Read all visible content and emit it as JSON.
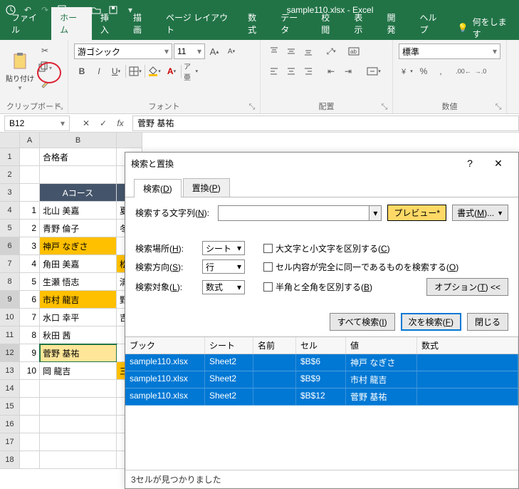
{
  "title": "sample110.xlsx - Excel",
  "qat": {
    "autosave": "autosave-icon",
    "items": [
      "undo-icon",
      "redo-icon",
      "new-icon",
      "open-icon",
      "open2-icon",
      "save-icon"
    ]
  },
  "tabs": {
    "file": "ファイル",
    "home": "ホーム",
    "insert": "挿入",
    "draw": "描画",
    "layout": "ページ レイアウト",
    "formula": "数式",
    "data": "データ",
    "review": "校閲",
    "view": "表示",
    "dev": "開発",
    "help": "ヘルプ",
    "tell": "何をします"
  },
  "ribbon": {
    "clipboard": {
      "paste": "貼り付け",
      "label": "クリップボード"
    },
    "font": {
      "name": "游ゴシック",
      "size": "11",
      "b": "B",
      "i": "I",
      "u": "U",
      "label": "フォント"
    },
    "align": {
      "label": "配置"
    },
    "number": {
      "style": "標準",
      "label": "数値"
    }
  },
  "formulabar": {
    "namebox": "B12",
    "value": "菅野 基祐"
  },
  "sheet": {
    "colheads": [
      "A",
      "B"
    ],
    "a1": "合格者",
    "b_header": "Aコース",
    "rows": [
      {
        "n": "1",
        "name": "北山 美嘉",
        "c": "夏"
      },
      {
        "n": "2",
        "name": "青野 倫子",
        "c": "冬"
      },
      {
        "n": "3",
        "name": "神戸 なぎさ",
        "c": "",
        "hl": true,
        "row_sel": true
      },
      {
        "n": "4",
        "name": "角田 美嘉",
        "c": "松",
        "chl": true
      },
      {
        "n": "5",
        "name": "生瀬 悟志",
        "c": "清"
      },
      {
        "n": "6",
        "name": "市村 龍吉",
        "c": "野",
        "hl": true,
        "row_sel": true
      },
      {
        "n": "7",
        "name": "水口 幸平",
        "c": "吉"
      },
      {
        "n": "8",
        "name": "秋田 茜",
        "c": ""
      },
      {
        "n": "9",
        "name": "菅野 基祐",
        "c": "",
        "hl2": true,
        "sel": true,
        "row_sel": true
      },
      {
        "n": "10",
        "name": "岡 龍吉",
        "c": "三",
        "chl": true
      }
    ]
  },
  "dialog": {
    "title": "検索と置換",
    "tab_find": "検索(D)",
    "tab_replace": "置換(P)",
    "find_label": "検索する文字列(N):",
    "preview": "プレビュー*",
    "format_btn": "書式(M)...",
    "loc_label": "検索場所(H):",
    "loc_val": "シート",
    "dir_label": "検索方向(S):",
    "dir_val": "行",
    "look_label": "検索対象(L):",
    "look_val": "数式",
    "chk_case": "大文字と小文字を区別する(C)",
    "chk_whole": "セル内容が完全に同一であるものを検索する(O)",
    "chk_width": "半角と全角を区別する(B)",
    "options_btn": "オプション(T) <<",
    "find_all": "すべて検索(I)",
    "find_next": "次を検索(F)",
    "close": "閉じる",
    "cols": {
      "book": "ブック",
      "sheet": "シート",
      "name": "名前",
      "cell": "セル",
      "val": "値",
      "fm": "数式"
    },
    "results": [
      {
        "book": "sample110.xlsx",
        "sheet": "Sheet2",
        "name": "",
        "cell": "$B$6",
        "val": "神戸 なぎさ"
      },
      {
        "book": "sample110.xlsx",
        "sheet": "Sheet2",
        "name": "",
        "cell": "$B$9",
        "val": "市村 龍吉"
      },
      {
        "book": "sample110.xlsx",
        "sheet": "Sheet2",
        "name": "",
        "cell": "$B$12",
        "val": "菅野 基祐"
      }
    ],
    "status": "3セルが見つかりました"
  }
}
